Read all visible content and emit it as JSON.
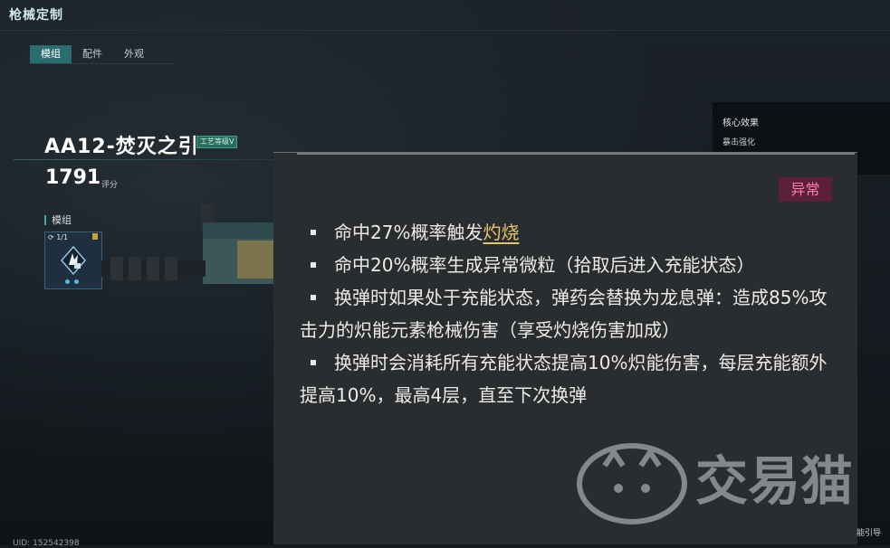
{
  "header": {
    "title": "枪械定制"
  },
  "tabs": [
    {
      "label": "模组",
      "active": true
    },
    {
      "label": "配件",
      "active": false
    },
    {
      "label": "外观",
      "active": false
    }
  ],
  "weapon": {
    "name": "AA12-焚灭之引",
    "craft_badge": "工艺等级Ⅴ",
    "score": "1791",
    "score_label": "评分"
  },
  "modules": {
    "section_label": "模组",
    "card": {
      "count": "1/1",
      "icon": "burning-module-icon"
    }
  },
  "side_panel": {
    "title": "核心效果",
    "item": "暴击强化"
  },
  "popup": {
    "tag": "异常",
    "tag_color": "#ff7eb2",
    "effects": [
      {
        "text_before": "命中27%概率触发",
        "keyword": "灼烧",
        "text_after": ""
      },
      {
        "text_before": "命中20%概率生成异常微粒（拾取后进入充能状态）",
        "keyword": "",
        "text_after": ""
      },
      {
        "text_before": "换弹时如果处于充能状态，弹药会替换为龙息弹：造成85%攻击力的炽能元素枪械伤害（享受灼烧伤害加成）",
        "keyword": "",
        "text_after": ""
      },
      {
        "text_before": "换弹时会消耗所有充能状态提高10%炽能伤害，每层充能额外提高10%，最高4层，直至下次换弹",
        "keyword": "",
        "text_after": ""
      }
    ]
  },
  "watermark": {
    "text": "交易猫"
  },
  "footer": {
    "uid": "UID: 152542398",
    "guide": "能引导"
  }
}
